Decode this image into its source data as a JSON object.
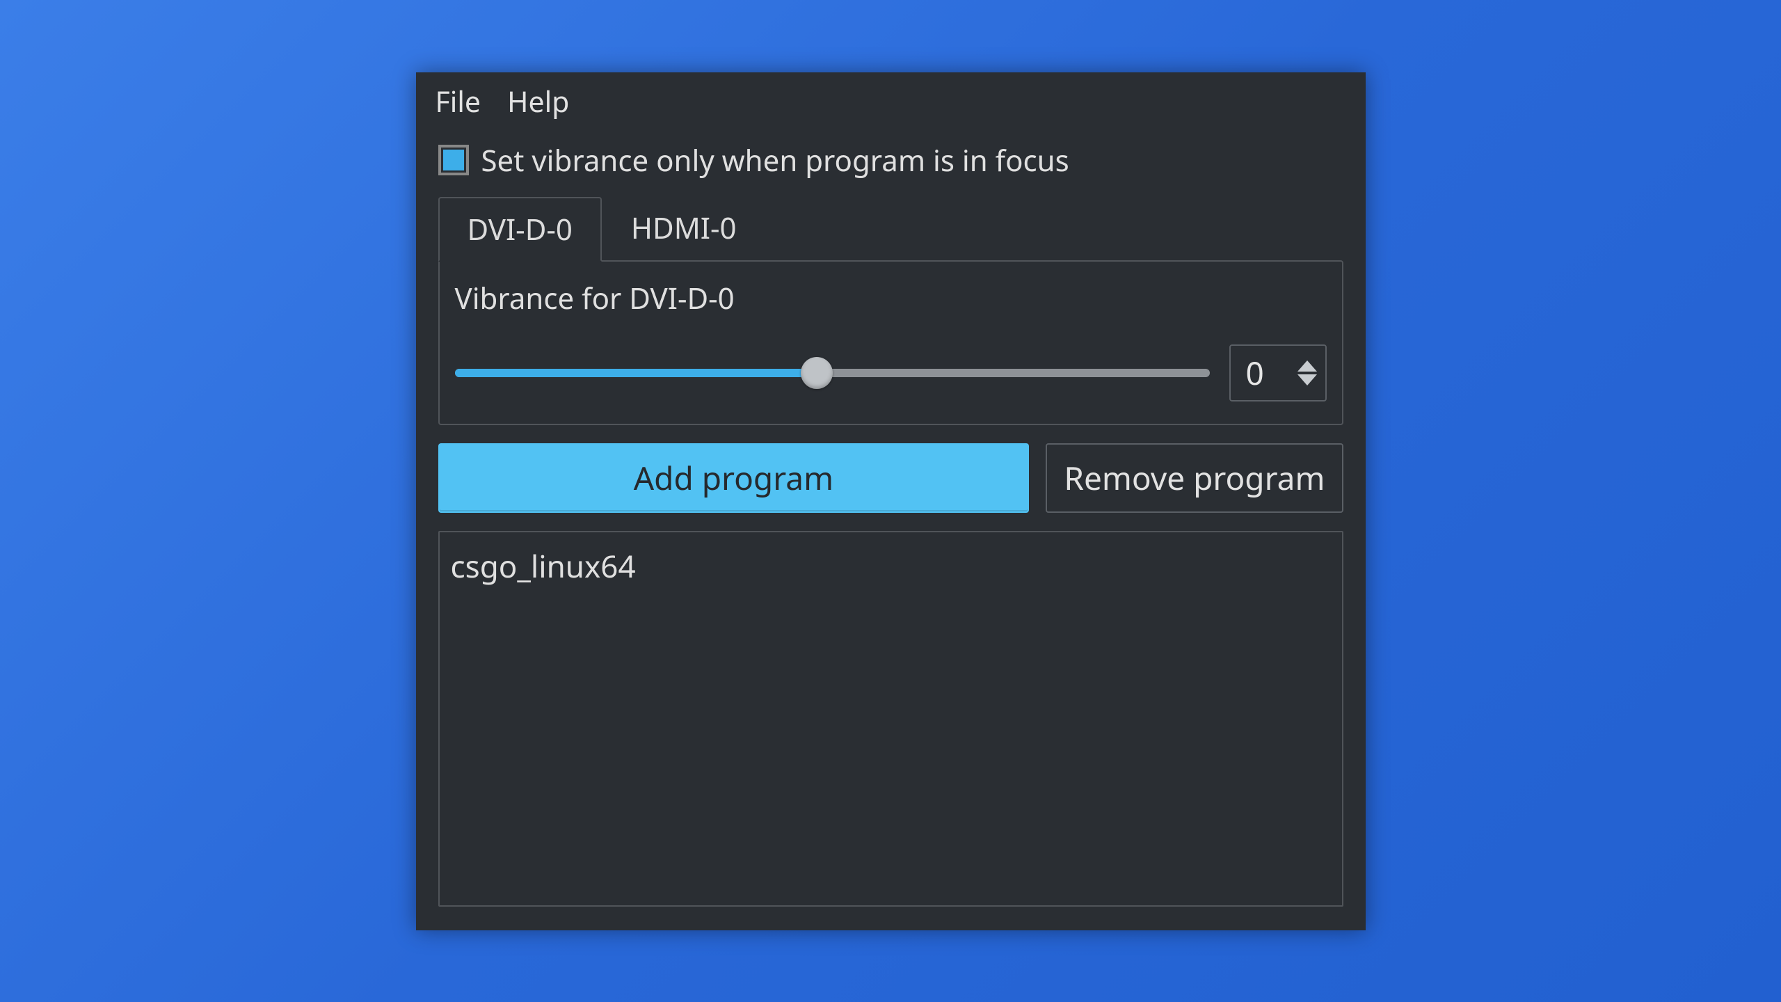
{
  "menu": {
    "file": "File",
    "help": "Help"
  },
  "checkbox": {
    "label": "Set vibrance only when program is in focus",
    "checked": true
  },
  "tabs": [
    {
      "id": "dvi",
      "label": "DVI-D-0",
      "active": true
    },
    {
      "id": "hdmi",
      "label": "HDMI-0",
      "active": false
    }
  ],
  "vibrance": {
    "panel_title": "Vibrance for DVI-D-0",
    "value": "0",
    "slider_percent": 48
  },
  "buttons": {
    "add": "Add program",
    "remove": "Remove program"
  },
  "programs": [
    {
      "name": "csgo_linux64"
    }
  ],
  "colors": {
    "accent": "#3daee9",
    "window_bg": "#2a2e33",
    "border": "#505459"
  }
}
